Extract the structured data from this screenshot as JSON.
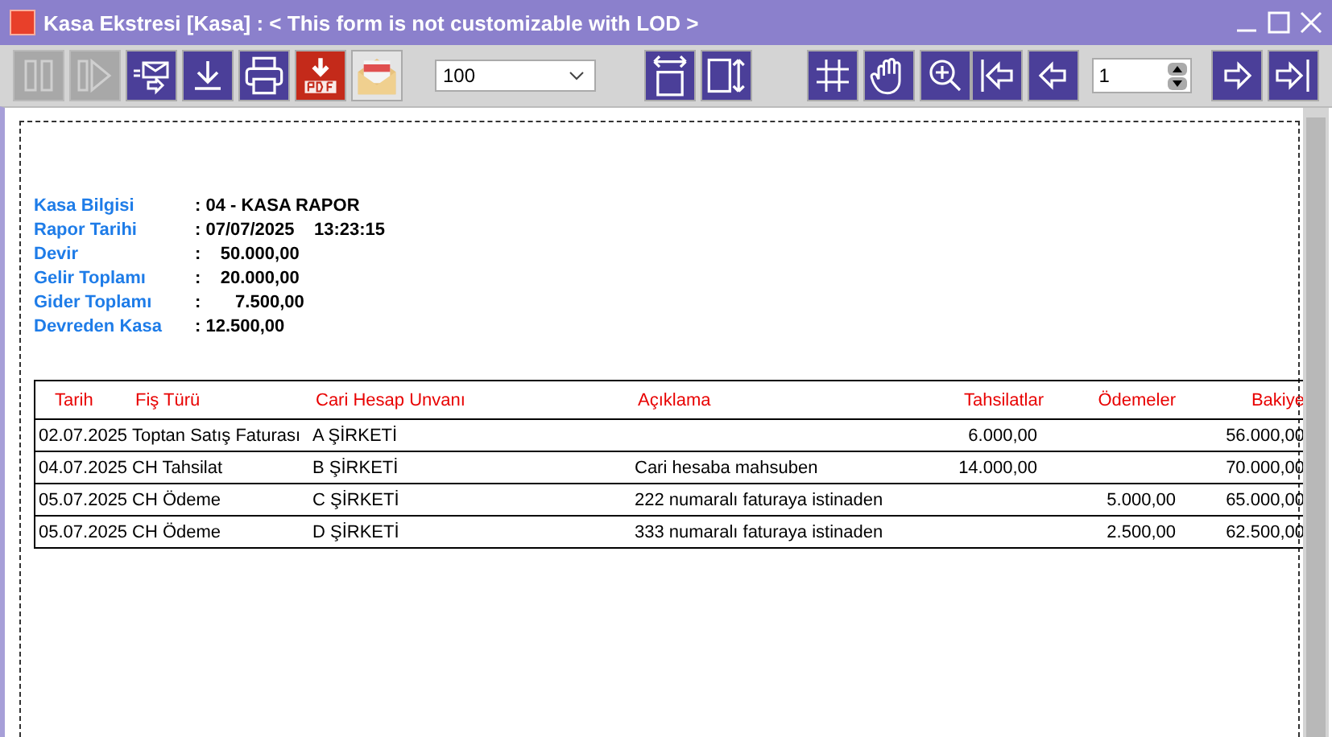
{
  "window": {
    "title": "Kasa Ekstresi [Kasa] : < This form is not customizable with LOD >"
  },
  "toolbar": {
    "buttons": [
      {
        "disabled": true
      },
      {
        "disabled": true
      },
      {
        "disabled": false
      },
      {
        "disabled": false
      },
      {
        "disabled": false
      },
      {
        "disabled": false
      },
      {
        "disabled": false
      }
    ],
    "zoom": "100",
    "page": "1"
  },
  "report": {
    "info": [
      {
        "label": "Kasa Bilgisi",
        "value": ": 04 - KASA RAPOR"
      },
      {
        "label": "Rapor Tarihi",
        "value": ": 07/07/2025    13:23:15"
      },
      {
        "label": "Devir",
        "value": ":    50.000,00"
      },
      {
        "label": "Gelir Toplamı",
        "value": ":    20.000,00"
      },
      {
        "label": "Gider Toplamı",
        "value": ":       7.500,00"
      },
      {
        "label": "Devreden Kasa",
        "value": ": 12.500,00"
      }
    ],
    "columns": [
      "Tarih",
      "Fiş Türü",
      "Cari Hesap Unvanı",
      "Açıklama",
      "Tahsilatlar",
      "Ödemeler",
      "Bakiye"
    ],
    "rows": [
      [
        "02.07.2025",
        "Toptan Satış Faturası",
        "A ŞİRKETİ",
        "",
        "6.000,00",
        "",
        "56.000,00"
      ],
      [
        "04.07.2025",
        "CH Tahsilat",
        "B ŞİRKETİ",
        "Cari hesaba mahsuben",
        "14.000,00",
        "",
        "70.000,00"
      ],
      [
        "05.07.2025",
        "CH Ödeme",
        "C ŞİRKETİ",
        "222 numaralı faturaya istinaden",
        "",
        "5.000,00",
        "65.000,00"
      ],
      [
        "05.07.2025",
        "CH Ödeme",
        "D ŞİRKETİ",
        "333 numaralı faturaya istinaden",
        "",
        "2.500,00",
        "62.500,00"
      ]
    ]
  }
}
